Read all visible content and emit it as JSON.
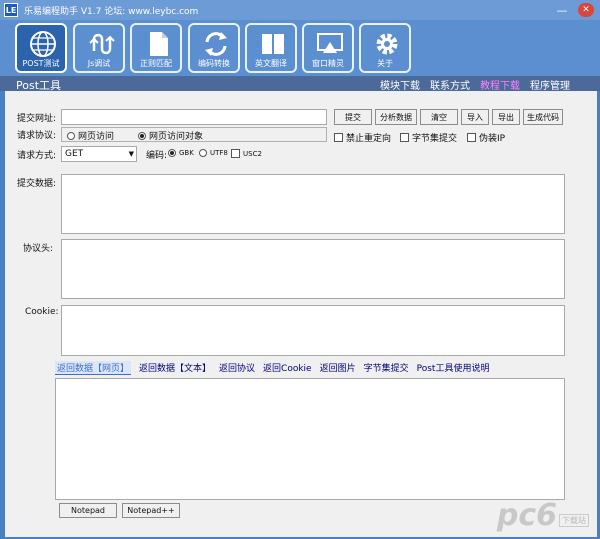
{
  "window": {
    "logo": "LE",
    "title": "乐易编程助手 V1.7 论坛: www.leybc.com",
    "minimize": "—",
    "close": "✕"
  },
  "toolbar": {
    "tools": [
      {
        "label": "POST测试",
        "icon": "globe-icon"
      },
      {
        "label": "Js调试",
        "icon": "js-debug-icon"
      },
      {
        "label": "正则匹配",
        "icon": "document-icon"
      },
      {
        "label": "编码转换",
        "icon": "refresh-icon"
      },
      {
        "label": "英文翻译",
        "icon": "book-icon"
      },
      {
        "label": "窗口精灵",
        "icon": "monitor-icon"
      },
      {
        "label": "关于",
        "icon": "gear-icon"
      }
    ]
  },
  "section": {
    "title": "Post工具",
    "nav": [
      "模块下载",
      "联系方式",
      "教程下载",
      "程序管理"
    ],
    "highlight_color": "#ff80ff"
  },
  "form": {
    "url_label": "提交网址:",
    "url_value": "",
    "buttons": {
      "submit": "提交",
      "analyze": "分析数据",
      "clear": "清空",
      "import": "导入",
      "export": "导出",
      "generate": "生成代码"
    },
    "protocol_label": "请求协议:",
    "protocol_options": [
      "网页访问",
      "网页访问对象"
    ],
    "no_redirect": "禁止重定向",
    "byte_submit": "字节集提交",
    "fake_ip": "伪装IP",
    "method_label": "请求方式:",
    "method_value": "GET",
    "encoding_label": "编码:",
    "encoding_options": [
      "GBK",
      "UTF8",
      "USC2"
    ],
    "data_label": "提交数据:",
    "header_label": "协议头:",
    "cookie_label": "Cookie:"
  },
  "tabs": [
    "返回数据【网页】",
    "返回数据【文本】",
    "返回协议",
    "返回Cookie",
    "返回图片",
    "字节集提交",
    "Post工具使用说明"
  ],
  "footer": {
    "notepad": "Notepad",
    "notepadpp": "Notepad++",
    "brand": "pc6",
    "download": "下载站"
  }
}
